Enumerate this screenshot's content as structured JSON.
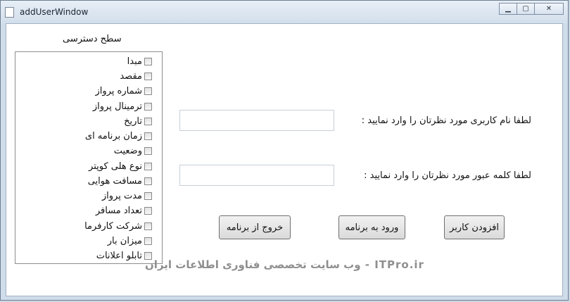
{
  "window": {
    "title": "addUserWindow",
    "minimize_symbol": "▁",
    "maximize_symbol": "▢",
    "close_symbol": "✕"
  },
  "access": {
    "title": "سطح دسترسی",
    "items": [
      "مبدا",
      "مقصد",
      "شماره پرواز",
      "ترمینال پرواز",
      "تاریخ",
      "زمان برنامه ای",
      "وضعیت",
      "نوع هلی کوپتر",
      "مسافت هوایی",
      "مدت پرواز",
      "تعداد مسافر",
      "شرکت کارفرما",
      "میزان بار",
      "تابلو اعلانات"
    ]
  },
  "form": {
    "username_label": "لطفا نام کاربری مورد نظرتان را وارد نمایید :",
    "username_value": "",
    "password_label": "لطفا کلمه عبور مورد نظرتان را وارد نمایید :",
    "password_value": ""
  },
  "buttons": {
    "exit": "خروج از برنامه",
    "login": "ورود به برنامه",
    "add_user": "افزودن کاربر"
  },
  "watermark": "ITPro.ir - وب سایت تخصصی فناوری اطلاعات ایران"
}
